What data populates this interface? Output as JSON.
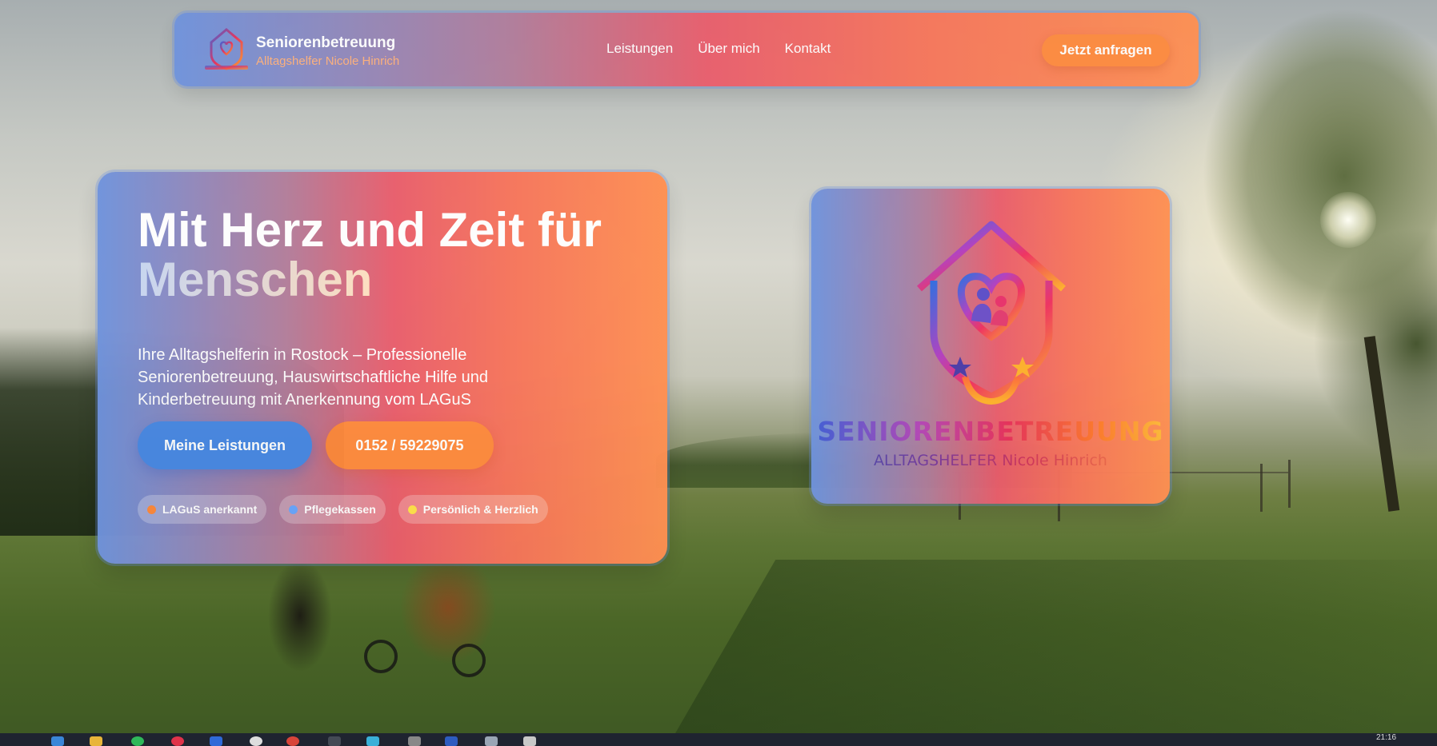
{
  "header": {
    "brand_title": "Seniorenbetreuung",
    "brand_subtitle": "Alltagshelfer Nicole Hinrich",
    "nav": [
      {
        "label": "Leistungen"
      },
      {
        "label": "Über mich"
      },
      {
        "label": "Kontakt"
      }
    ],
    "cta_label": "Jetzt anfragen"
  },
  "hero": {
    "title_line1": "Mit Herz und Zeit für",
    "title_line2": "Menschen",
    "text": "Ihre Alltagshelferin in Rostock – Professionelle Seniorenbetreuung, Hauswirtschaftliche Hilfe und Kinderbetreuung mit Anerkennung vom LAGuS",
    "primary_button": "Meine Leistungen",
    "phone_button": "0152 / 59229075",
    "badges": [
      {
        "label": "LAGuS anerkannt",
        "color": "#ff8a3d"
      },
      {
        "label": "Pflegekassen",
        "color": "#6aa7ff"
      },
      {
        "label": "Persönlich & Herzlich",
        "color": "#ffe14a"
      }
    ]
  },
  "logo_card": {
    "title": "SENIORENBETREUUNG",
    "subtitle": "ALLTAGSHELFER Nicole Hinrich"
  },
  "taskbar": {
    "clock": "21:16"
  }
}
